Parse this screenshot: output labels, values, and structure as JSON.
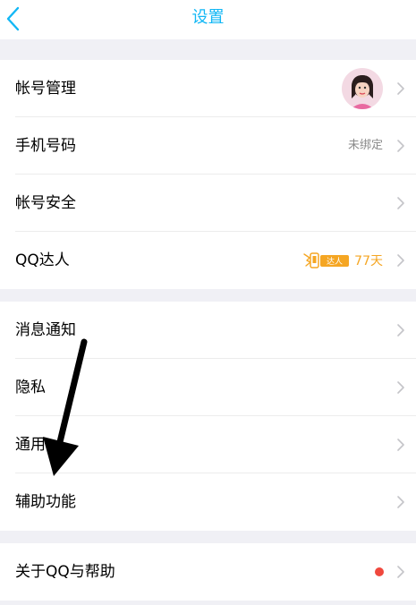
{
  "nav": {
    "title": "设置",
    "back_icon": "chevron-left-icon"
  },
  "groups": [
    {
      "rows": [
        {
          "label": "帐号管理",
          "trailing": "avatar"
        },
        {
          "label": "手机号码",
          "value": "未绑定"
        },
        {
          "label": "帐号安全"
        },
        {
          "label": "QQ达人",
          "badge_text": "达人",
          "days": "77天"
        }
      ]
    },
    {
      "rows": [
        {
          "label": "消息通知"
        },
        {
          "label": "隐私"
        },
        {
          "label": "通用"
        },
        {
          "label": "辅助功能"
        }
      ]
    },
    {
      "rows": [
        {
          "label": "关于QQ与帮助",
          "has_red_dot": true
        }
      ]
    }
  ],
  "colors": {
    "accent": "#12b7f5",
    "background": "#f0f0f5",
    "badge": "#f5a623",
    "red_dot": "#f0483d"
  }
}
